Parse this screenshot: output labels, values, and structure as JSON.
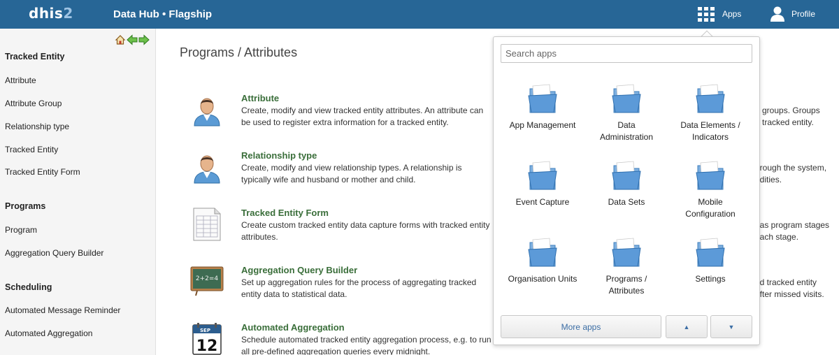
{
  "header": {
    "logo_main": "dhis",
    "logo_num": "2",
    "title": "Data Hub • Flagship",
    "apps_label": "Apps",
    "profile_label": "Profile"
  },
  "sidebar": {
    "groups": [
      {
        "heading": "Tracked Entity",
        "items": [
          "Attribute",
          "Attribute Group",
          "Relationship type",
          "Tracked Entity",
          "Tracked Entity Form"
        ]
      },
      {
        "heading": "Programs",
        "items": [
          "Program",
          "Aggregation Query Builder"
        ]
      },
      {
        "heading": "Scheduling",
        "items": [
          "Automated Message Reminder",
          "Automated Aggregation"
        ]
      }
    ]
  },
  "main": {
    "title": "Programs / Attributes",
    "items": [
      {
        "title": "Attribute",
        "desc": "Create, modify and view tracked entity attributes. An attribute can be used to register extra information for a tracked entity.",
        "icon": "person-icon"
      },
      {
        "title": "Relationship type",
        "desc": "Create, modify and view relationship types. A relationship is typically wife and husband or mother and child.",
        "icon": "person-icon"
      },
      {
        "title": "Tracked Entity Form",
        "desc": "Create custom tracked entity data capture forms with tracked entity attributes.",
        "icon": "form-icon"
      },
      {
        "title": "Aggregation Query Builder",
        "desc": "Set up aggregation rules for the process of aggregating tracked entity data to statistical data.",
        "icon": "chalkboard-icon"
      },
      {
        "title": "Automated Aggregation",
        "desc": "Schedule automated tracked entity aggregation process, e.g. to run all pre-defined aggregation queries every midnight.",
        "icon": "calendar-icon"
      }
    ],
    "right_fragments": [
      [
        "e groups. Groups",
        "a tracked entity."
      ],
      [
        "hrough the system,",
        "odities."
      ],
      [
        "has program stages",
        "each stage."
      ],
      [
        "ed tracked entity",
        "after missed visits."
      ]
    ],
    "calendar_month": "SEP",
    "calendar_day": "12",
    "chalk_text": "2+2=4"
  },
  "apps_menu": {
    "search_placeholder": "Search apps",
    "apps": [
      [
        "App Management"
      ],
      [
        "Data",
        "Administration"
      ],
      [
        "Data Elements /",
        "Indicators"
      ],
      [
        "Event Capture"
      ],
      [
        "Data Sets"
      ],
      [
        "Mobile",
        "Configuration"
      ],
      [
        "Organisation Units"
      ],
      [
        "Programs /",
        "Attributes"
      ],
      [
        "Settings"
      ]
    ],
    "more_label": "More apps",
    "up_glyph": "▲",
    "down_glyph": "▼"
  },
  "colors": {
    "header": "#276696",
    "link_green": "#3a6e3a",
    "menu_button_text": "#3c6ea5"
  }
}
